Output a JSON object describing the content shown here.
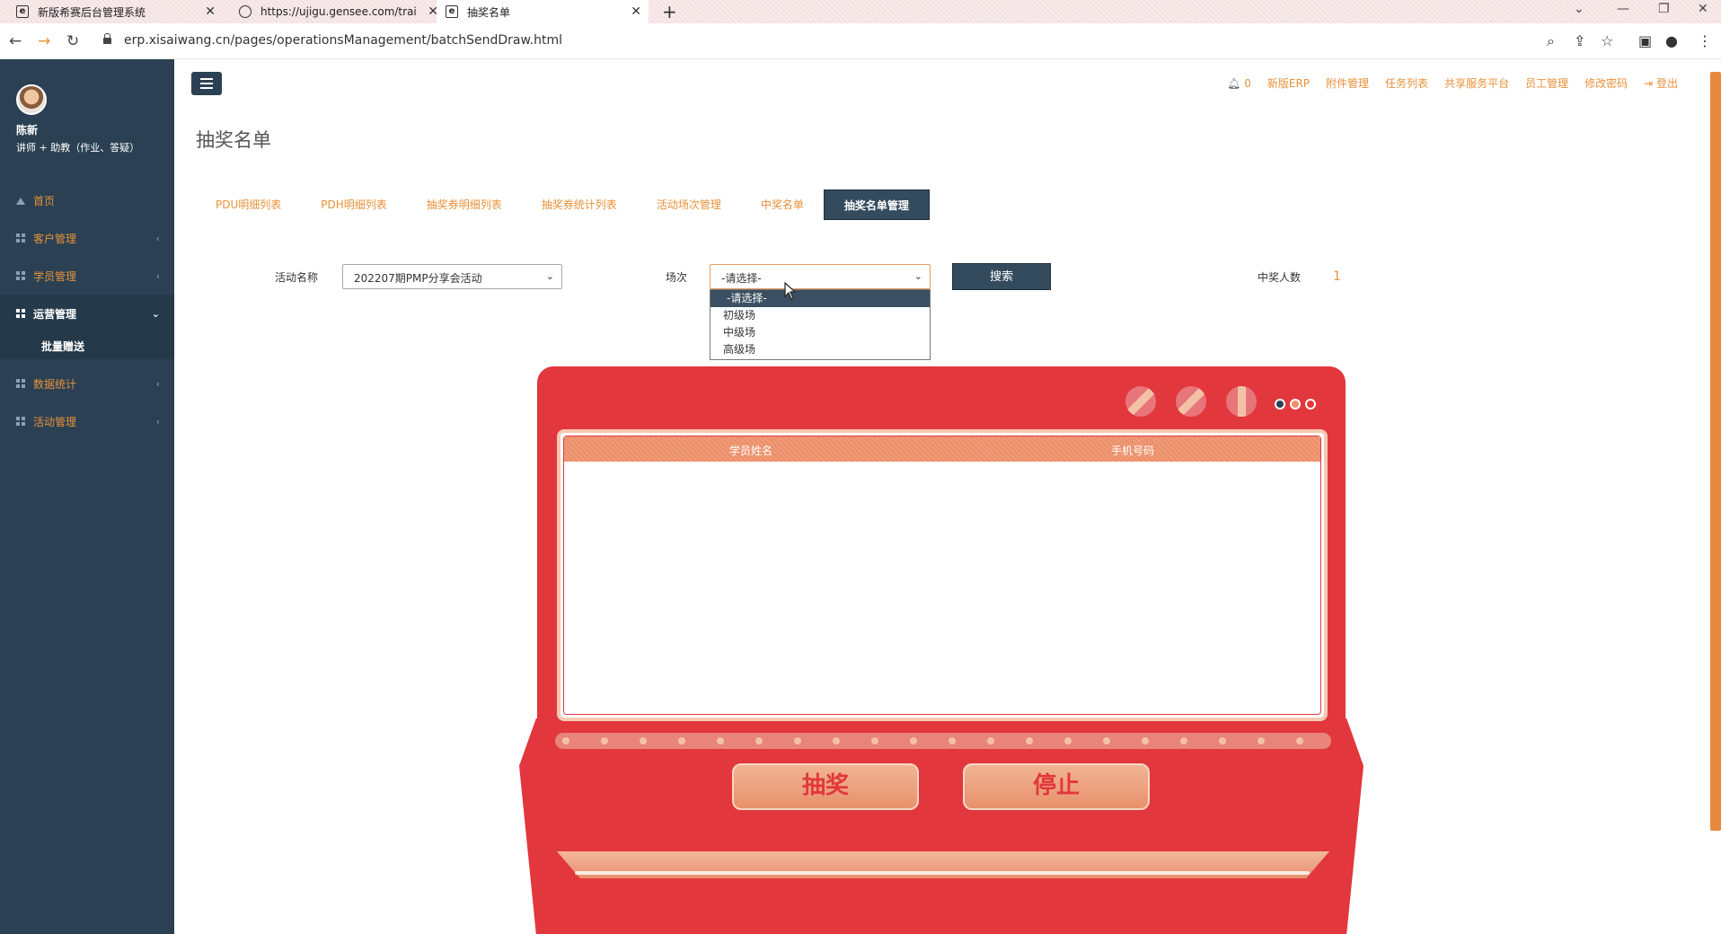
{
  "browser": {
    "tabs": [
      {
        "title": "新版希赛后台管理系统",
        "icon": "page-icon"
      },
      {
        "title": "https://ujigu.gensee.com/trai",
        "icon": "globe-icon"
      },
      {
        "title": "抽奖名单",
        "icon": "page-icon"
      }
    ],
    "url": "erp.xisaiwang.cn/pages/operationsManagement/batchSendDraw.html"
  },
  "user": {
    "name": "陈新",
    "role": "讲师 + 助教（作业、答疑）"
  },
  "sidebar": {
    "items": [
      {
        "label": "首页"
      },
      {
        "label": "客户管理"
      },
      {
        "label": "学员管理"
      },
      {
        "label": "运营管理"
      },
      {
        "label": "数据统计"
      },
      {
        "label": "活动管理"
      }
    ],
    "submenu": {
      "label": "批量赠送"
    }
  },
  "header": {
    "bell_count": "0",
    "links": [
      "新版ERP",
      "附件管理",
      "任务列表",
      "共享服务平台",
      "员工管理",
      "修改密码",
      "登出"
    ]
  },
  "page": {
    "title": "抽奖名单"
  },
  "tabs": [
    {
      "label": "PDU明细列表"
    },
    {
      "label": "PDH明细列表"
    },
    {
      "label": "抽奖券明细列表"
    },
    {
      "label": "抽奖券统计列表"
    },
    {
      "label": "活动场次管理"
    },
    {
      "label": "中奖名单"
    },
    {
      "label": "抽奖名单管理"
    }
  ],
  "form": {
    "activity_label": "活动名称",
    "activity_value": "202207期PMP分享会活动",
    "session_label": "场次",
    "session_value": "-请选择-",
    "session_options": [
      "-请选择-",
      "初级场",
      "中级场",
      "高级场"
    ],
    "search_label": "搜索",
    "winners_label": "中奖人数",
    "winners_value": "1"
  },
  "machine": {
    "col_name": "学员姓名",
    "col_phone": "手机号码",
    "draw_label": "抽奖",
    "stop_label": "停止"
  }
}
